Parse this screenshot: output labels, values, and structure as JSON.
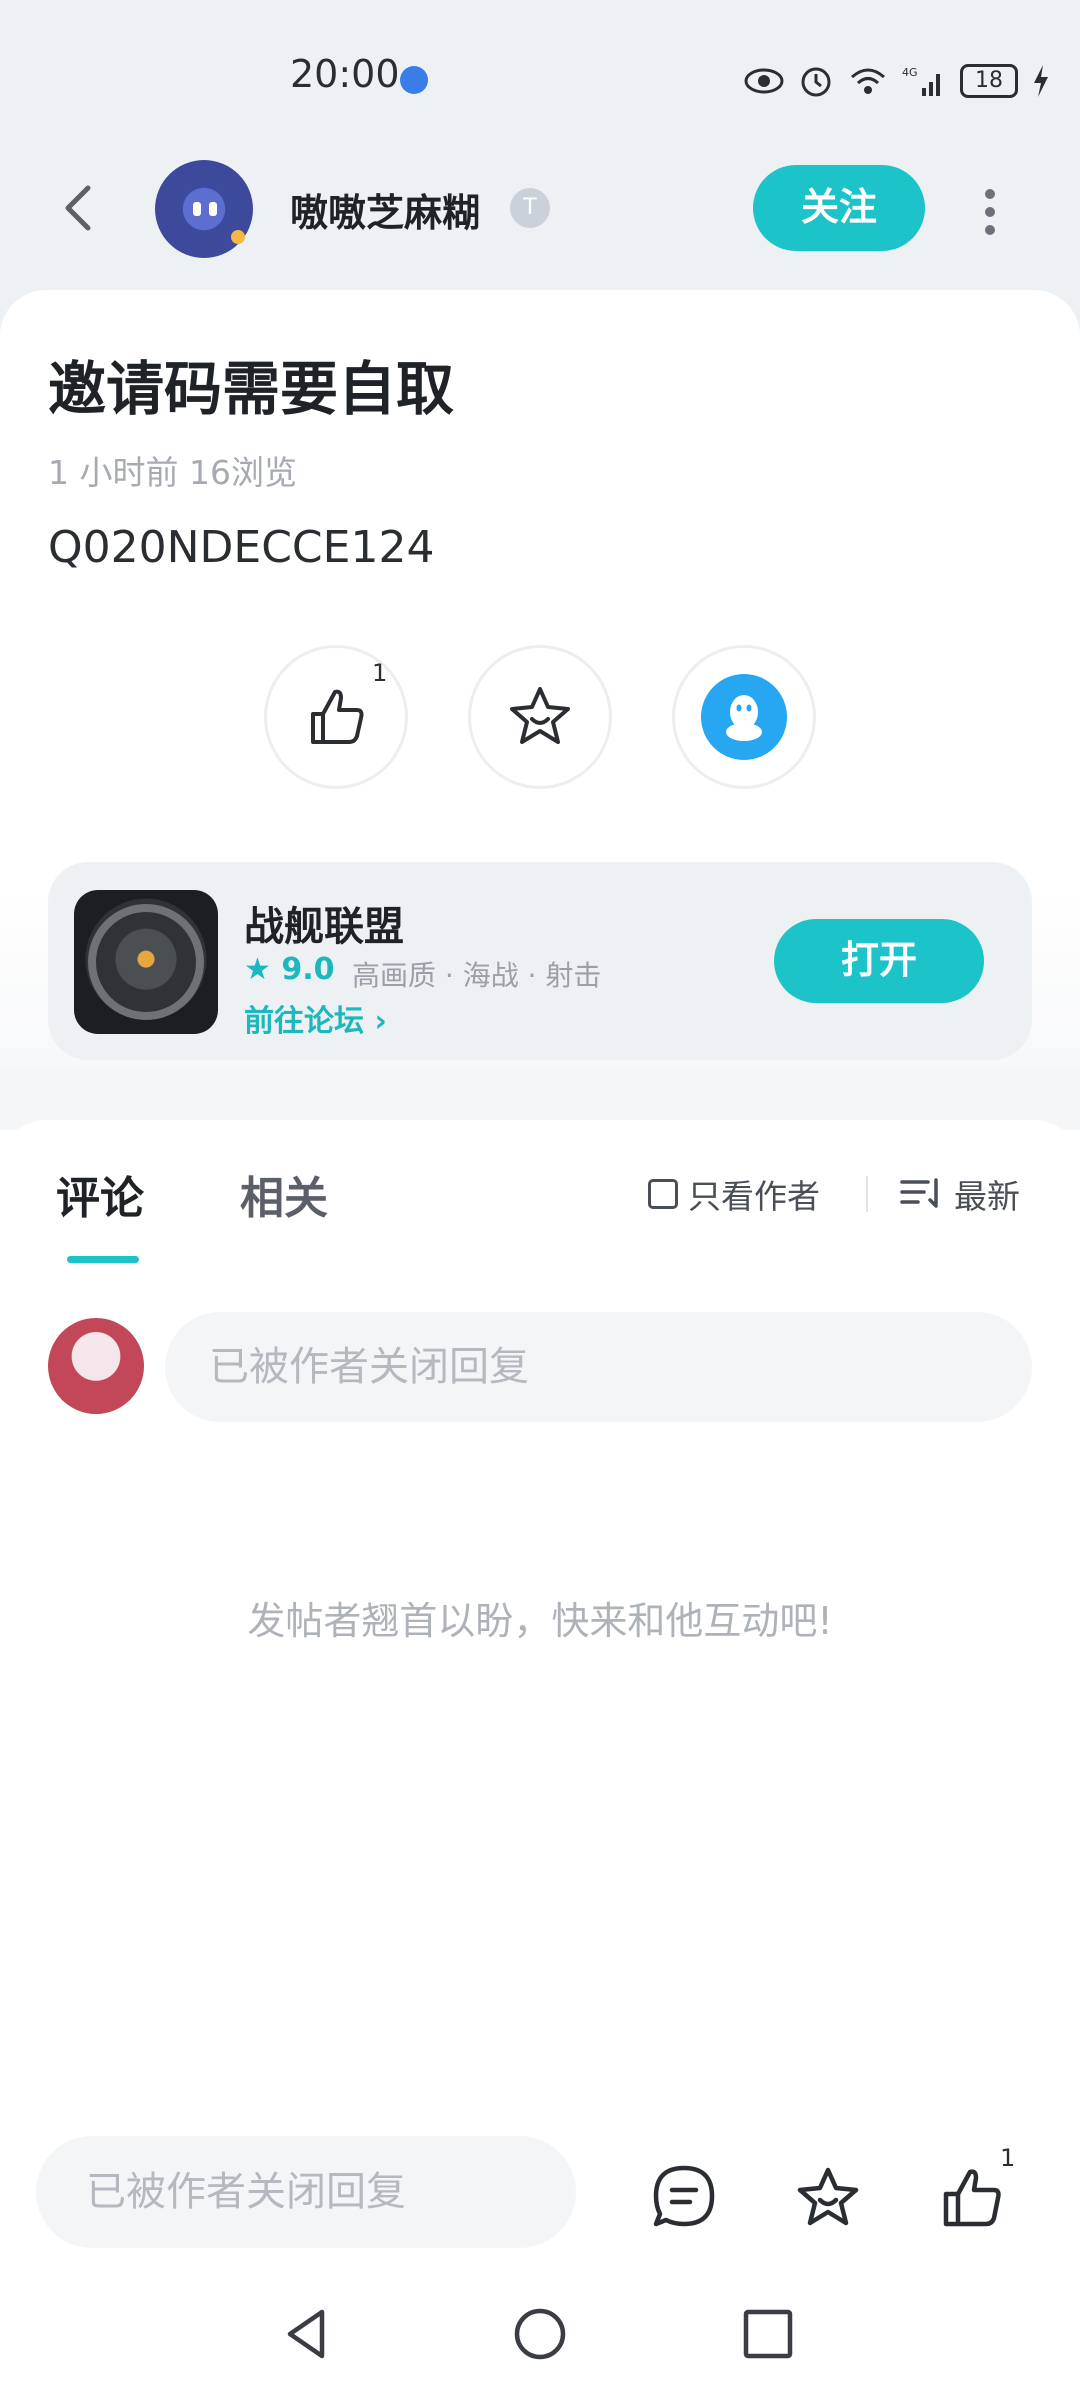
{
  "status_bar": {
    "time": "20:00",
    "battery": "18"
  },
  "header": {
    "username": "嗷嗷芝麻糊",
    "level_badge": "T",
    "follow_label": "关注"
  },
  "post": {
    "title": "邀请码需要自取",
    "meta": "1 小时前   16浏览",
    "body": "Q020NDECCE124",
    "like_count": "1"
  },
  "game": {
    "name": "战舰联盟",
    "rating": "9.0",
    "tags": "高画质 · 海战 · 射击",
    "link": "前往论坛",
    "open_label": "打开"
  },
  "comments": {
    "tabs": [
      "评论",
      "相关"
    ],
    "only_author": "只看作者",
    "sort": "最新",
    "reply_placeholder": "已被作者关闭回复",
    "empty_hint": "发帖者翘首以盼，快来和他互动吧!"
  },
  "bottom_bar": {
    "input_placeholder": "已被作者关闭回复",
    "like_count": "1"
  },
  "colors": {
    "accent": "#1cc3c9",
    "qq_blue": "#27a7f2"
  }
}
